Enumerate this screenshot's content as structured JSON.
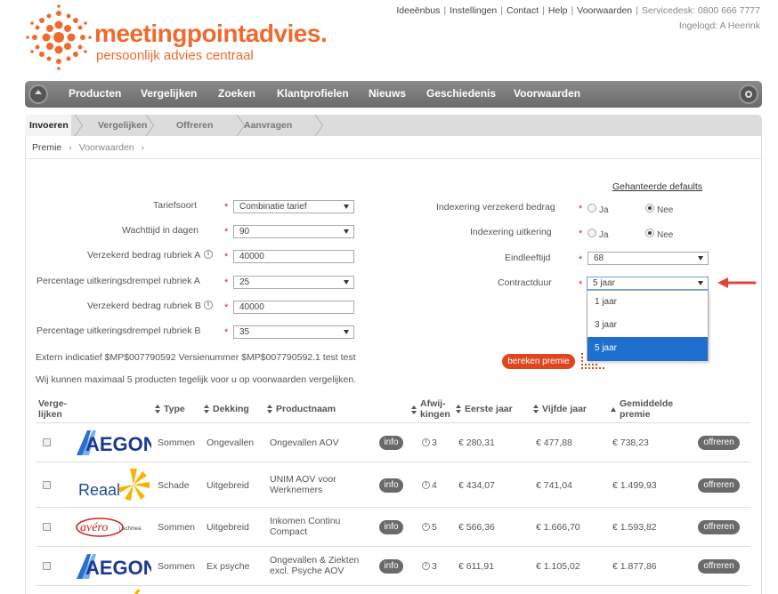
{
  "brand": {
    "name": "meetingpointadvies.",
    "tagline": "persoonlijk advies centraal",
    "primary_color": "#ef6a2c",
    "accent_red": "#e0451f",
    "selection_blue": "#1f6fd0"
  },
  "toplinks": {
    "items": [
      "Ideeënbus",
      "Instellingen",
      "Contact",
      "Help",
      "Voorwaarden"
    ],
    "servicedesk": "Servicedesk: 0800 666 7777",
    "logged_in": "Ingelogd: A Heerink"
  },
  "mainnav": {
    "items": [
      "Producten",
      "Vergelijken",
      "Zoeken",
      "Klantprofielen",
      "Nieuws",
      "Geschiedenis",
      "Voorwaarden"
    ]
  },
  "steps": [
    "Invoeren",
    "Vergelijken",
    "Offreren",
    "Aanvragen"
  ],
  "breadcrumb": {
    "current": "Premie",
    "next": "Voorwaarden"
  },
  "form": {
    "defaults_link": "Gehanteerde defaults",
    "left": [
      {
        "label": "Tariefsoort",
        "value": "Combinatie tarief",
        "type": "select"
      },
      {
        "label": "Wachttijd in dagen",
        "value": "90",
        "type": "select"
      },
      {
        "label": "Verzekerd bedrag rubriek A",
        "value": "40000",
        "type": "input"
      },
      {
        "label": "Percentage uitkeringsdrempel rubriek A",
        "value": "25",
        "type": "select"
      },
      {
        "label": "Verzekerd bedrag rubriek B",
        "value": "40000",
        "type": "input"
      },
      {
        "label": "Percentage uitkeringsdrempel rubriek B",
        "value": "35",
        "type": "select"
      }
    ],
    "right": [
      {
        "label": "Indexering verzekerd bedrag",
        "opt_yes": "Ja",
        "opt_no": "Nee"
      },
      {
        "label": "Indexering uitkering",
        "opt_yes": "Ja",
        "opt_no": "Nee"
      },
      {
        "label": "Eindleeftijd",
        "value": "68"
      },
      {
        "label": "Contractduur",
        "value": "5 jaar"
      }
    ],
    "contractduur_options": [
      "1 jaar",
      "3 jaar",
      "5 jaar"
    ],
    "contractduur_selected": "5 jaar",
    "calc_button": "bereken premie"
  },
  "notes": {
    "extern": "Extern indicatief $MP$007790592 Versienummer $MP$007790592.1 test test",
    "max": "Wij kunnen maximaal 5 producten tegelijk voor u op voorwaarden vergelijken."
  },
  "table": {
    "headers": {
      "vergelijken_1": "Verge-",
      "vergelijken_2": "lijken",
      "type": "Type",
      "dekking": "Dekking",
      "productnaam": "Productnaam",
      "afwijkingen_1": "Afwij-",
      "afwijkingen_2": "kingen",
      "eerste_jaar": "Eerste jaar",
      "vijfde_jaar": "Vijfde jaar",
      "gemiddelde_1": "Gemiddelde",
      "gemiddelde_2": "premie"
    },
    "info_label": "info",
    "offer_label": "offreren",
    "rows": [
      {
        "logo": "AEGON",
        "type": "Sommen",
        "dekking": "Ongevallen",
        "product_1": "Ongevallen AOV",
        "product_2": "",
        "afwijkingen": "3",
        "eerste": "€ 280,31",
        "vijfde": "€ 477,88",
        "gemiddelde": "€ 738,23"
      },
      {
        "logo": "Reaal",
        "type": "Schade",
        "dekking": "Uitgebreid",
        "product_1": "UNIM AOV voor",
        "product_2": "Werknemers",
        "afwijkingen": "4",
        "eerste": "€ 434,07",
        "vijfde": "€ 741,04",
        "gemiddelde": "€ 1.499,93"
      },
      {
        "logo": "avéro achmea",
        "type": "Sommen",
        "dekking": "Uitgebreid",
        "product_1": "Inkomen Continu",
        "product_2": "Compact",
        "afwijkingen": "5",
        "eerste": "€ 566,36",
        "vijfde": "€ 1.666,70",
        "gemiddelde": "€ 1.593,82"
      },
      {
        "logo": "AEGON",
        "type": "Sommen",
        "dekking": "Ex psyche",
        "product_1": "Ongevallen & Ziekten",
        "product_2": "excl. Psyche AOV",
        "afwijkingen": "3",
        "eerste": "€ 611,91",
        "vijfde": "€ 1.105,02",
        "gemiddelde": "€ 1.877,86"
      }
    ]
  }
}
